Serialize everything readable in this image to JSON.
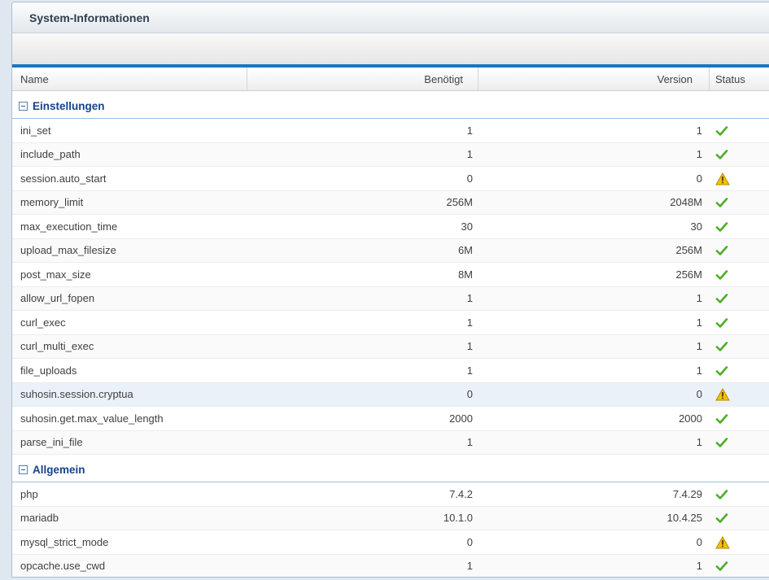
{
  "panel": {
    "title": "System-Informationen"
  },
  "columns": {
    "name": "Name",
    "required": "Benötigt",
    "version": "Version",
    "status": "Status"
  },
  "groups": [
    {
      "label": "Einstellungen",
      "rows": [
        {
          "name": "ini_set",
          "required": "1",
          "version": "1",
          "status": "ok"
        },
        {
          "name": "include_path",
          "required": "1",
          "version": "1",
          "status": "ok"
        },
        {
          "name": "session.auto_start",
          "required": "0",
          "version": "0",
          "status": "warning"
        },
        {
          "name": "memory_limit",
          "required": "256M",
          "version": "2048M",
          "status": "ok"
        },
        {
          "name": "max_execution_time",
          "required": "30",
          "version": "30",
          "status": "ok"
        },
        {
          "name": "upload_max_filesize",
          "required": "6M",
          "version": "256M",
          "status": "ok"
        },
        {
          "name": "post_max_size",
          "required": "8M",
          "version": "256M",
          "status": "ok"
        },
        {
          "name": "allow_url_fopen",
          "required": "1",
          "version": "1",
          "status": "ok"
        },
        {
          "name": "curl_exec",
          "required": "1",
          "version": "1",
          "status": "ok"
        },
        {
          "name": "curl_multi_exec",
          "required": "1",
          "version": "1",
          "status": "ok"
        },
        {
          "name": "file_uploads",
          "required": "1",
          "version": "1",
          "status": "ok"
        },
        {
          "name": "suhosin.session.cryptua",
          "required": "0",
          "version": "0",
          "status": "warning",
          "highlight": true
        },
        {
          "name": "suhosin.get.max_value_length",
          "required": "2000",
          "version": "2000",
          "status": "ok"
        },
        {
          "name": "parse_ini_file",
          "required": "1",
          "version": "1",
          "status": "ok"
        }
      ]
    },
    {
      "label": "Allgemein",
      "rows": [
        {
          "name": "php",
          "required": "7.4.2",
          "version": "7.4.29",
          "status": "ok"
        },
        {
          "name": "mariadb",
          "required": "10.1.0",
          "version": "10.4.25",
          "status": "ok"
        },
        {
          "name": "mysql_strict_mode",
          "required": "0",
          "version": "0",
          "status": "warning"
        },
        {
          "name": "opcache.use_cwd",
          "required": "1",
          "version": "1",
          "status": "ok"
        }
      ]
    }
  ],
  "colors": {
    "ok": "#4caf2a",
    "warning": "#f2c200",
    "accent": "#1a77c0",
    "group_text": "#15428b"
  },
  "icons": {
    "ok": "checkmark-icon",
    "warning": "warning-triangle-icon",
    "group_toggle": "collapse-minus-icon"
  }
}
